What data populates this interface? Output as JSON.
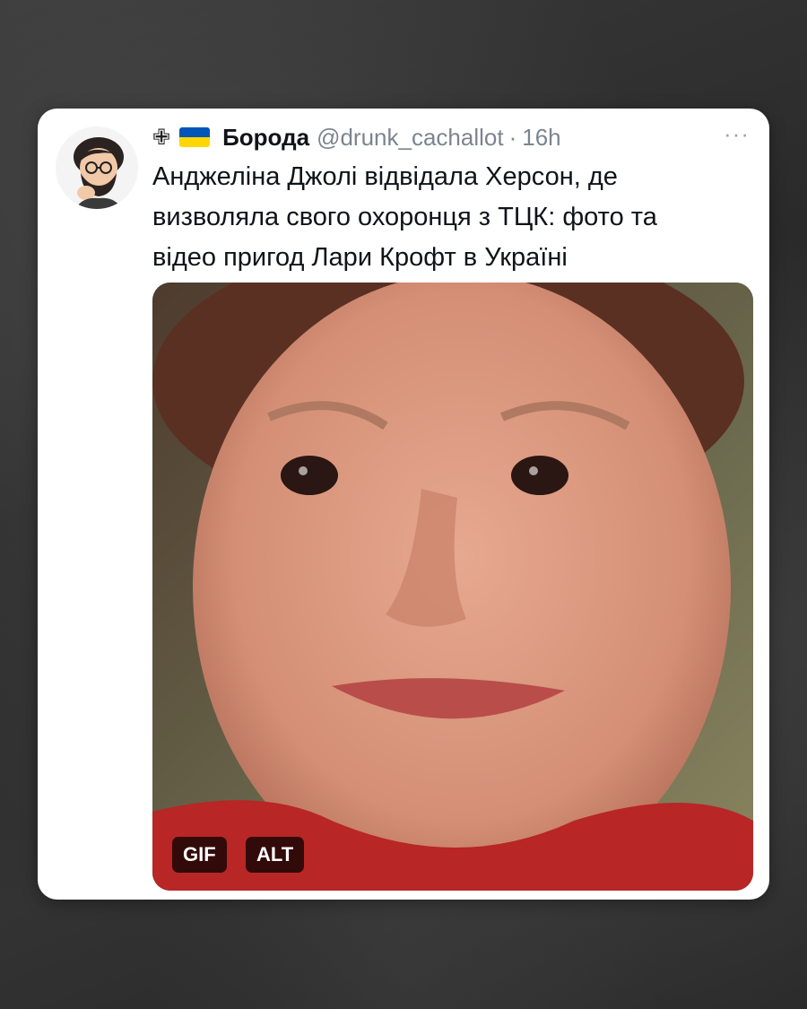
{
  "tweet": {
    "prefix_symbol": "✙",
    "flag_colors": [
      "#0057b7",
      "#ffd700"
    ],
    "display_name": "Борода",
    "handle": "@drunk_cachallot",
    "separator": "·",
    "time": "16h",
    "more_icon": "more-horizontal-icon",
    "text": "Анджеліна Джолі відвідала Херсон, де визволяла свого охоронця з ТЦК: фото та відео пригод Лари Крофт в Україні",
    "media": {
      "gif_label": "GIF",
      "alt_label": "ALT"
    }
  },
  "colors": {
    "card_bg": "#ffffff",
    "text_primary": "#0f1419",
    "text_secondary": "#7b858f",
    "badge_bg": "#000000"
  }
}
